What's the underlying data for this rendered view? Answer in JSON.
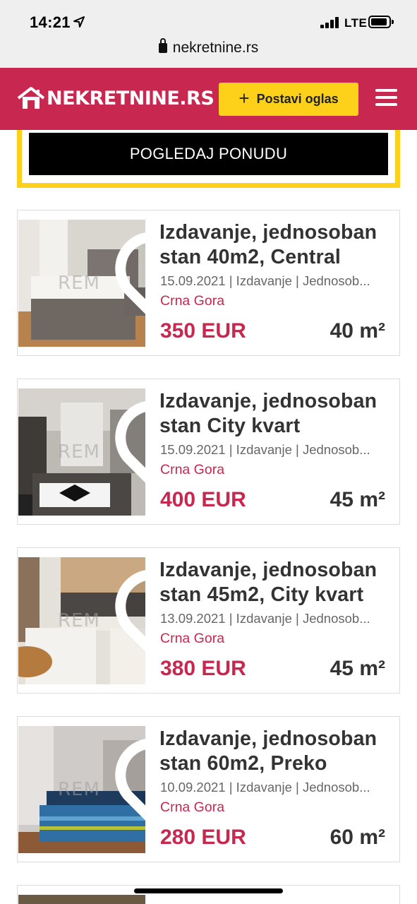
{
  "status_bar": {
    "time": "14:21",
    "network": "LTE"
  },
  "browser": {
    "url": "nekretnine.rs"
  },
  "header": {
    "logo_text": "NEKRETNINE.RS",
    "post_button_label": "Postavi oglas",
    "accent_color": "#c8284f",
    "button_color": "#fdd11a"
  },
  "banner": {
    "button_label": "POGLEDAJ PONUDU"
  },
  "listings": [
    {
      "title": "Izdavanje, jednosoban stan 40m2, Central",
      "meta": "15.09.2021 | Izdavanje | Jednosob...",
      "location": "Crna Gora",
      "price": "350 EUR",
      "area": "40 m²",
      "photo": "bedroom-photo"
    },
    {
      "title": "Izdavanje, jednosoban stan City kvart",
      "meta": "15.09.2021 | Izdavanje | Jednosob...",
      "location": "Crna Gora",
      "price": "400 EUR",
      "area": "45 m²",
      "photo": "living-room-photo"
    },
    {
      "title": "Izdavanje, jednosoban stan 45m2, City kvart",
      "meta": "13.09.2021 | Izdavanje | Jednosob...",
      "location": "Crna Gora",
      "price": "380 EUR",
      "area": "45 m²",
      "photo": "kitchen-photo"
    },
    {
      "title": "Izdavanje, jednosoban stan 60m2, Preko",
      "meta": "10.09.2021 | Izdavanje | Jednosob...",
      "location": "Crna Gora",
      "price": "280 EUR",
      "area": "60 m²",
      "photo": "bedroom-photo"
    }
  ],
  "watermark_text": "REM"
}
